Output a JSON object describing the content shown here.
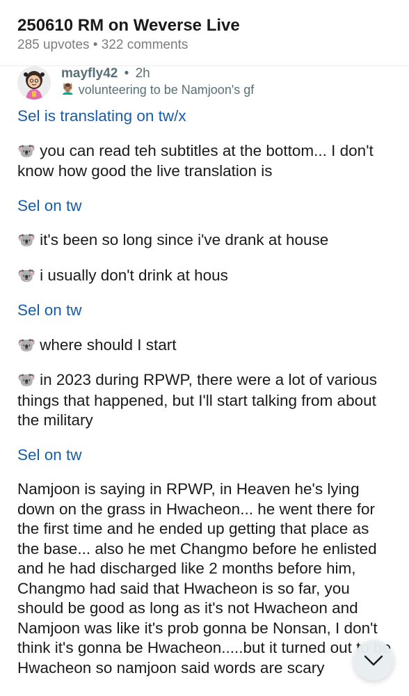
{
  "post": {
    "title": "250610 RM on Weverse Live",
    "meta": "285 upvotes • 322 comments"
  },
  "comment": {
    "author": "mayfly42",
    "separator": "•",
    "time": "2h",
    "flair_emoji": "💆🏽‍♂️",
    "flair_text": "volunteering to be Namjoon's gf",
    "avatar_icon": "snoo-avatar-icon",
    "koala_emoji": "🐨",
    "paragraphs": {
      "p1": "Sel is translating on tw/x",
      "p2": "you can read teh subtitles at the bottom... I don't know how good the live translation is",
      "p3": "Sel on tw",
      "p4": "it's been so long since i've drank at house",
      "p5": "i usually don't drink at hous",
      "p6": "Sel on tw",
      "p7": "where should I start",
      "p8": "in 2023 during RPWP, there were a lot of various things that happened, but I'll start talking from about the military",
      "p9": "Sel on tw",
      "p10": "Namjoon is saying in RPWP, in Heaven he's lying down on the grass in Hwacheon... he went there for the first time and he ended up getting that place as the base... also he met Changmo before he enlisted and he had discharged like 2 months before him, Changmo had said that Hwacheon is so far, you should be good as long as it's not Hwacheon and Namjoon was like it's prob gonna be Nonsan, I don't think it's gonna be Hwacheon.....but it turned out to be Hwacheon so namjoon said words are scary"
    }
  },
  "colors": {
    "link": "#1a5ca8",
    "meta": "#7c7c7c",
    "author": "#576f76"
  },
  "fab_icon": "chevron-down-icon"
}
